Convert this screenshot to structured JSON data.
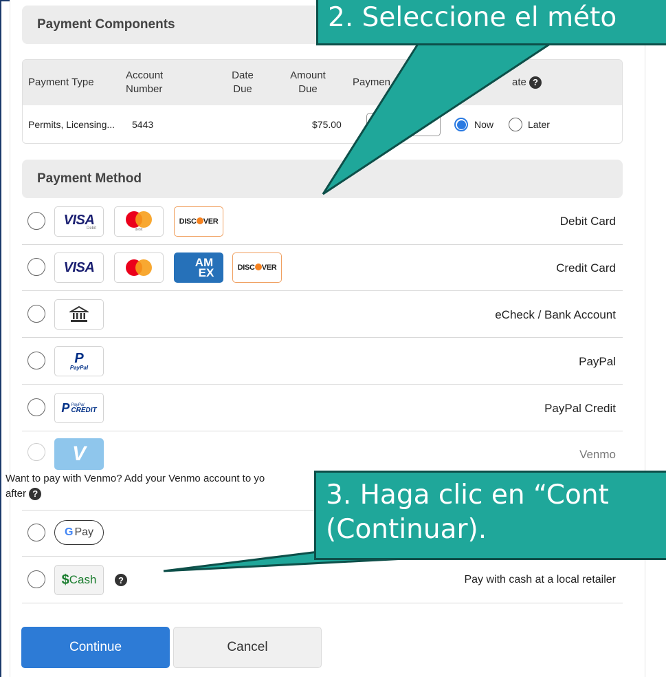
{
  "payment_components": {
    "header": "Payment Components",
    "columns": [
      "Payment Type",
      "Account Number",
      "Date Due",
      "Amount Due",
      "Paymen",
      "ate"
    ],
    "row": {
      "payment_type": "Permits, Licensing...",
      "account_number": "5443",
      "date_due": "",
      "amount_due": "$75.00",
      "date_options": [
        "Now",
        "Later"
      ],
      "selected_date_option": "Now"
    }
  },
  "payment_method": {
    "header": "Payment Method",
    "options": [
      {
        "label": "Debit Card",
        "logos": [
          "visa",
          "mastercard",
          "discover"
        ],
        "logo_captions": [
          "Debit",
          "debit"
        ]
      },
      {
        "label": "Credit Card",
        "logos": [
          "visa",
          "mastercard",
          "amex",
          "discover"
        ]
      },
      {
        "label": "eCheck / Bank Account",
        "logos": [
          "bank-icon"
        ]
      },
      {
        "label": "PayPal",
        "logos": [
          "paypal"
        ]
      },
      {
        "label": "PayPal Credit",
        "logos": [
          "paypal-credit"
        ]
      },
      {
        "label": "Venmo",
        "logos": [
          "venmo"
        ],
        "note": "Want to pay with Venmo? Add your Venmo account to yo",
        "note2": "after"
      },
      {
        "label": "",
        "logos": [
          "google-pay"
        ]
      },
      {
        "label": "Pay with cash at a local retailer",
        "logos": [
          "cash"
        ]
      }
    ]
  },
  "logo_text": {
    "visa": "VISA",
    "discover": "DISC",
    "discover_end": "VER",
    "amex_top": "AM",
    "amex_bottom": "EX",
    "paypal": "PayPal",
    "paypal_credit": "CREDIT",
    "paypal_credit_small": "PayPal",
    "venmo": "V",
    "gpay": "Pay",
    "gpay_g": "G",
    "cash": "Cash",
    "cash_symbol": "$"
  },
  "buttons": {
    "continue": "Continue",
    "cancel": "Cancel"
  },
  "callouts": {
    "step2": "2. Seleccione el méto",
    "step3_line1": "3. Haga clic en “Cont",
    "step3_line2": "(Continuar)."
  },
  "colors": {
    "accent": "#2d7bd6",
    "callout_fill": "#1fa79a",
    "callout_border": "#0d4f49",
    "venmo": "#3d95ce",
    "mastercard_red": "#eb001b",
    "mastercard_orange": "#f79e1b",
    "amex": "#2671b9",
    "discover_orange": "#f58220"
  }
}
